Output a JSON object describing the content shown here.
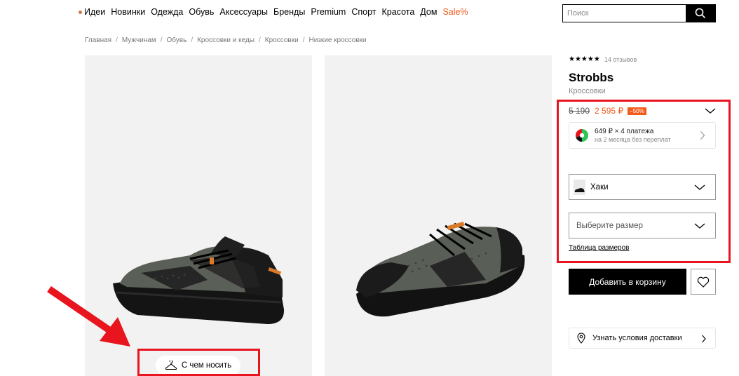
{
  "nav": {
    "items": [
      "Идеи",
      "Новинки",
      "Одежда",
      "Обувь",
      "Аксессуары",
      "Бренды",
      "Premium",
      "Спорт",
      "Красота",
      "Дом"
    ],
    "sale": "Sale%"
  },
  "search": {
    "placeholder": "Поиск",
    "icon": "search-icon"
  },
  "breadcrumb": [
    "Главная",
    "Мужчинам",
    "Обувь",
    "Кроссовки и кеды",
    "Кроссовки",
    "Низкие кроссовки"
  ],
  "gallery": {
    "wear_button": "С чем носить",
    "wear_icon": "hanger-icon"
  },
  "product": {
    "rating": 5,
    "reviews": "14 отзывов",
    "brand": "Strobbs",
    "category": "Кроссовки",
    "old_price": "5 190",
    "new_price": "2 595 ₽",
    "discount": "−50%",
    "installments": {
      "main": "649 ₽ × 4 платежа",
      "sub": "на 2 месяца без переплат"
    },
    "color": "Хаки",
    "size_placeholder": "Выберите размер",
    "size_table": "Таблица размеров",
    "add_to_cart": "Добавить в корзину",
    "delivery": "Узнать условия доставки"
  },
  "colors": {
    "accent": "#f45b1a",
    "highlight": "#e8141e",
    "photo_bg": "#f2f2f2"
  }
}
